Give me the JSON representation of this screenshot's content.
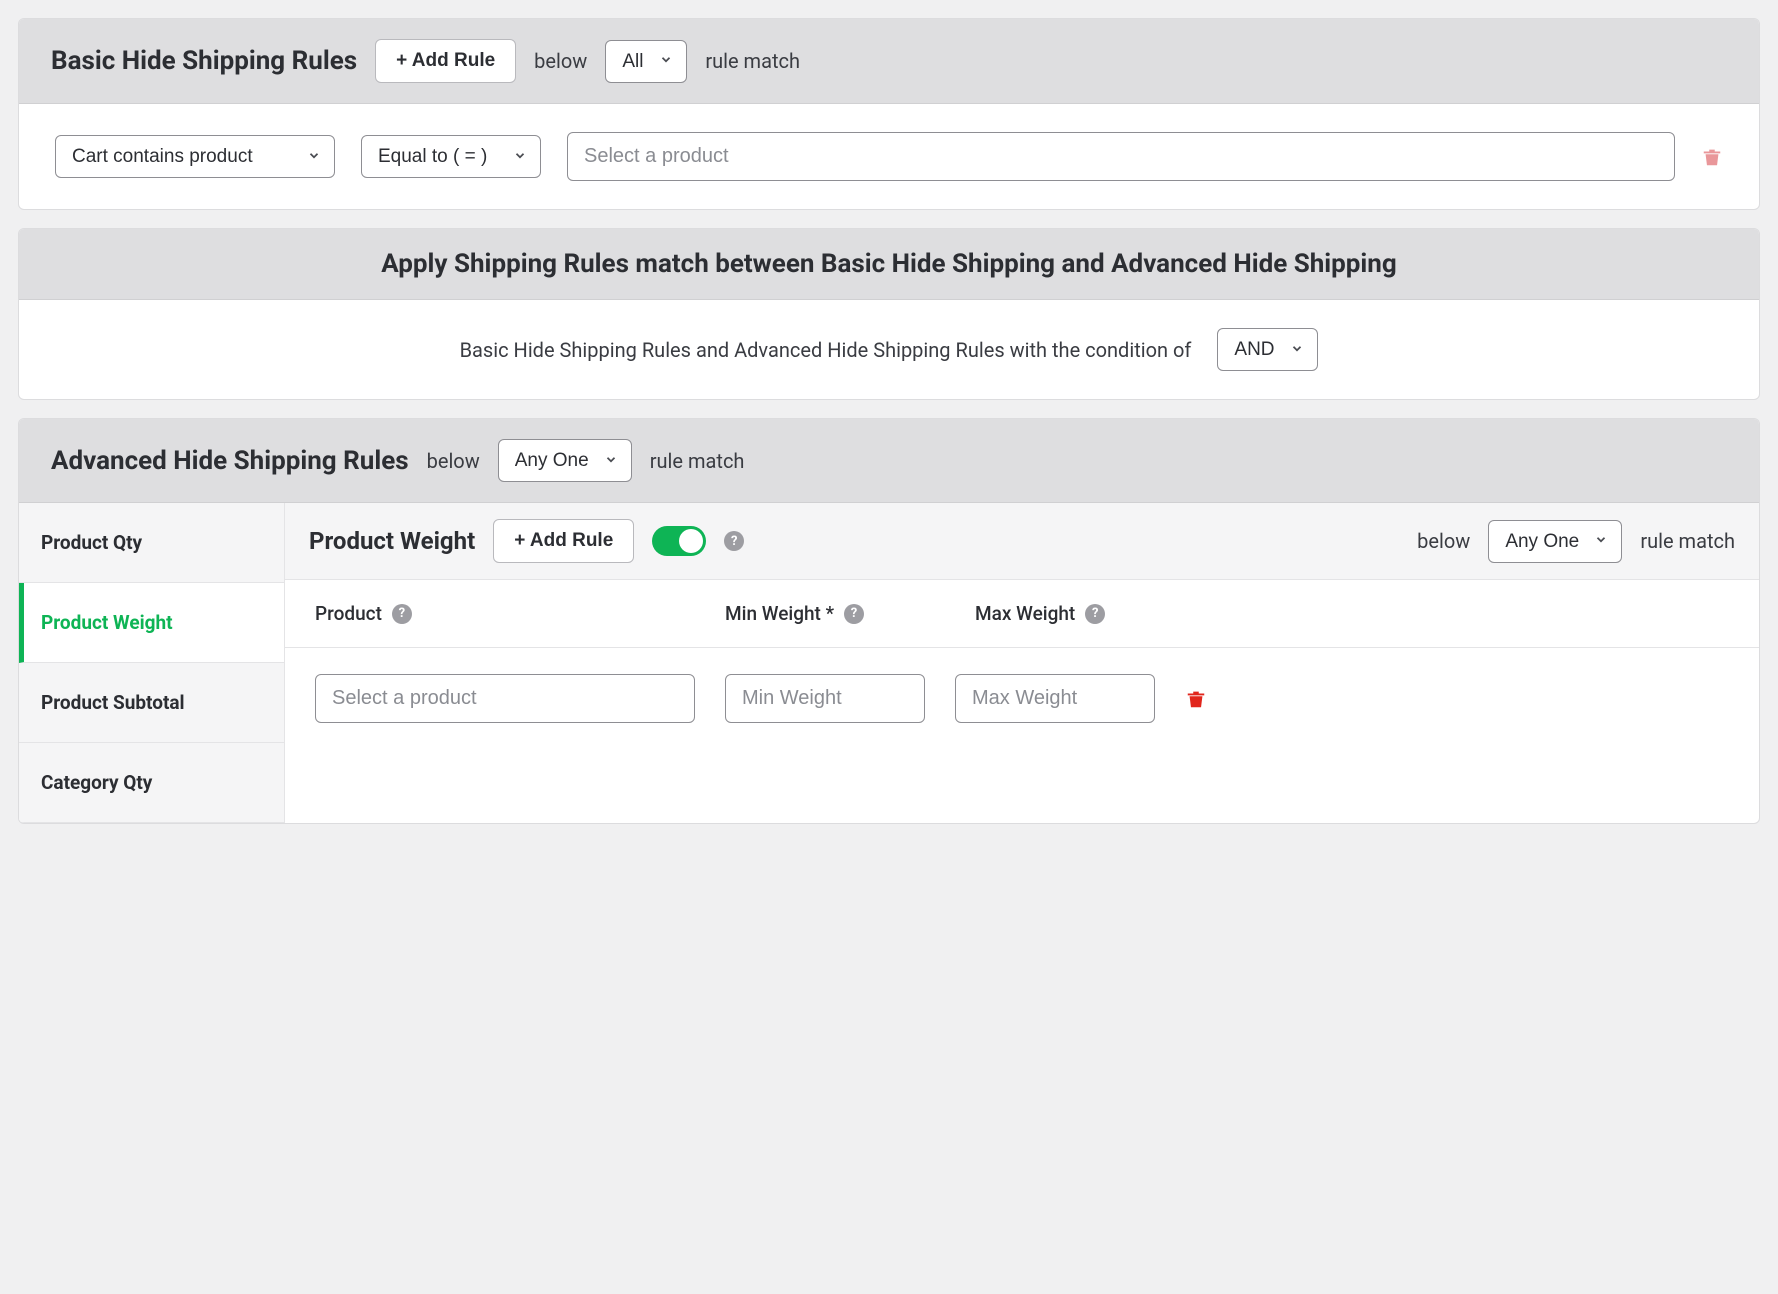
{
  "basic": {
    "title": "Basic Hide Shipping Rules",
    "add_rule_label": "+ Add Rule",
    "below_label": "below",
    "match_select": "All",
    "rule_match_label": "rule match",
    "row": {
      "condition_select": "Cart contains product",
      "operator_select": "Equal to ( = )",
      "product_placeholder": "Select a product"
    }
  },
  "apply": {
    "header": "Apply Shipping Rules match between Basic Hide Shipping and Advanced Hide Shipping",
    "body_text": "Basic Hide Shipping Rules and Advanced Hide Shipping Rules with the condition of",
    "condition_select": "AND"
  },
  "advanced": {
    "title": "Advanced Hide Shipping Rules",
    "below_label": "below",
    "match_select": "Any One",
    "rule_match_label": "rule match",
    "sidebar": {
      "items": [
        {
          "label": "Product Qty"
        },
        {
          "label": "Product Weight"
        },
        {
          "label": "Product Subtotal"
        },
        {
          "label": "Category Qty"
        }
      ]
    },
    "pane": {
      "title": "Product Weight",
      "add_rule_label": "+ Add Rule",
      "below_label": "below",
      "match_select": "Any One",
      "rule_match_label": "rule match",
      "columns": {
        "product": "Product",
        "min": "Min Weight *",
        "max": "Max Weight"
      },
      "row": {
        "product_placeholder": "Select a product",
        "min_placeholder": "Min Weight",
        "max_placeholder": "Max Weight"
      }
    }
  }
}
